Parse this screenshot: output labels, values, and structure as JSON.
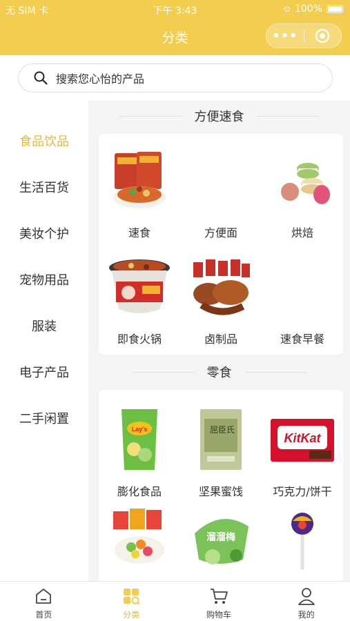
{
  "status": {
    "carrier": "无 SIM 卡",
    "time": "下午 3:43",
    "battery": "100%"
  },
  "header": {
    "title": "分类",
    "more_icon": "more-dots-icon",
    "close_icon": "target-icon"
  },
  "search": {
    "placeholder": "搜索您心怡的产品"
  },
  "sidebar": {
    "items": [
      {
        "label": "食品饮品",
        "active": true
      },
      {
        "label": "生活百货"
      },
      {
        "label": "美妆个护"
      },
      {
        "label": "宠物用品"
      },
      {
        "label": "服装"
      },
      {
        "label": "电子产品"
      },
      {
        "label": "二手闲置"
      }
    ]
  },
  "sections": [
    {
      "title": "方便速食",
      "items": [
        {
          "label": "速食",
          "icon": "instant-food-image"
        },
        {
          "label": "方便面",
          "icon": ""
        },
        {
          "label": "烘焙",
          "icon": "macaron-image"
        },
        {
          "label": "即食火锅",
          "icon": "self-heating-hotpot-image"
        },
        {
          "label": "卤制品",
          "icon": "braised-snacks-image"
        },
        {
          "label": "速食早餐",
          "icon": ""
        }
      ]
    },
    {
      "title": "零食",
      "items": [
        {
          "label": "膨化食品",
          "icon": "chips-bag-image"
        },
        {
          "label": "坚果蜜饯",
          "icon": "preserved-fruit-pack-image"
        },
        {
          "label": "巧克力/饼干",
          "icon": "kitkat-image"
        },
        {
          "label": "",
          "icon": "jelly-candy-image"
        },
        {
          "label": "",
          "icon": "plum-image"
        },
        {
          "label": "",
          "icon": "lollipop-image"
        }
      ]
    }
  ],
  "product_texts": {
    "kitkat": "KitKat",
    "lays": "Lay's",
    "plum": "溜溜梅",
    "pack": "屈臣氏"
  },
  "tabbar": [
    {
      "label": "首页",
      "icon": "home-icon"
    },
    {
      "label": "分类",
      "icon": "category-icon",
      "active": true
    },
    {
      "label": "购物车",
      "icon": "cart-icon"
    },
    {
      "label": "我的",
      "icon": "user-icon"
    }
  ],
  "colors": {
    "brand": "#f2cd4f",
    "accent": "#e7b93a"
  }
}
